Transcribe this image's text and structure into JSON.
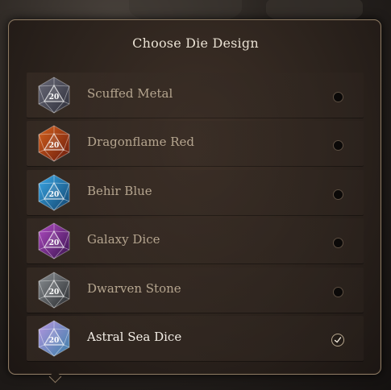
{
  "dialog": {
    "title": "Choose Die Design",
    "options": [
      {
        "label": "Scuffed Metal",
        "icon": "die-scuffed-metal-icon",
        "face": "20",
        "selected": false,
        "colors": [
          "#6a6a78",
          "#2e2f3a"
        ]
      },
      {
        "label": "Dragonflame Red",
        "icon": "die-dragonflame-red-icon",
        "face": "20",
        "selected": false,
        "colors": [
          "#d4621e",
          "#6a1a0c"
        ]
      },
      {
        "label": "Behir Blue",
        "icon": "die-behir-blue-icon",
        "face": "20",
        "selected": false,
        "colors": [
          "#3aa7e6",
          "#12446e"
        ]
      },
      {
        "label": "Galaxy Dice",
        "icon": "die-galaxy-icon",
        "face": "20",
        "selected": false,
        "colors": [
          "#b04cc2",
          "#3a1250"
        ]
      },
      {
        "label": "Dwarven Stone",
        "icon": "die-dwarven-stone-icon",
        "face": "20",
        "selected": false,
        "colors": [
          "#8a8f93",
          "#2a2c2f"
        ]
      },
      {
        "label": "Astral Sea Dice",
        "icon": "die-astral-sea-icon",
        "face": "20",
        "selected": true,
        "colors": [
          "#b596e0",
          "#3b7fa8"
        ]
      }
    ]
  }
}
